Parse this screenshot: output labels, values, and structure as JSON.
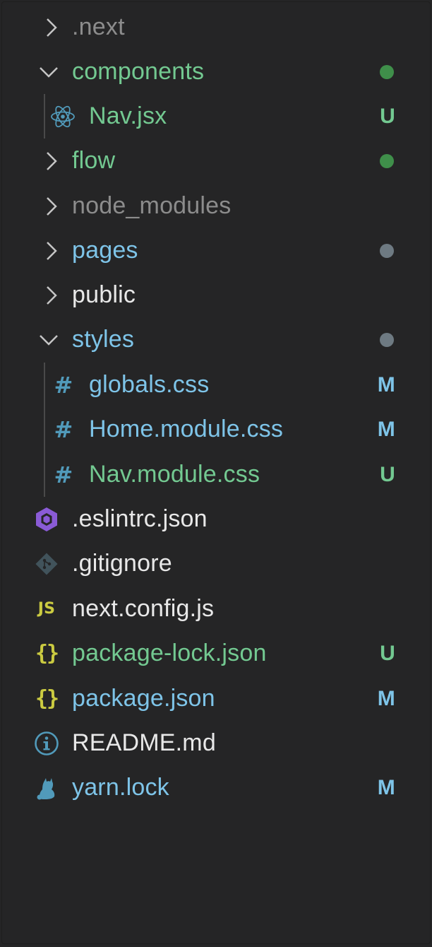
{
  "colors": {
    "untracked": "#73c991",
    "modified": "#7ec4e8",
    "ignored": "#8c8c8c",
    "default": "#e8e8e8",
    "dot_green": "#3f8f4a",
    "dot_gray": "#6e7a82",
    "badge_u": "#73c991",
    "badge_m": "#7ec4e8"
  },
  "tree": {
    "next_folder": "next",
    "components_folder": "components",
    "nav_jsx": "Nav.jsx",
    "flow_folder": "flow",
    "node_modules_folder": "node_modules",
    "pages_folder": "pages",
    "public_folder": "public",
    "styles_folder": "styles",
    "globals_css": "globals.css",
    "home_module_css": "Home.module.css",
    "nav_module_css": "Nav.module.css",
    "eslintrc": ".eslintrc.json",
    "gitignore": ".gitignore",
    "next_config": "next.config.js",
    "package_lock": "package-lock.json",
    "package_json": "package.json",
    "readme": "README.md",
    "yarn_lock": "yarn.lock"
  },
  "badges": {
    "untracked": "U",
    "modified": "M"
  },
  "icons": {
    "js_text": "JS",
    "json_text": "{}",
    "css_text": "#"
  }
}
